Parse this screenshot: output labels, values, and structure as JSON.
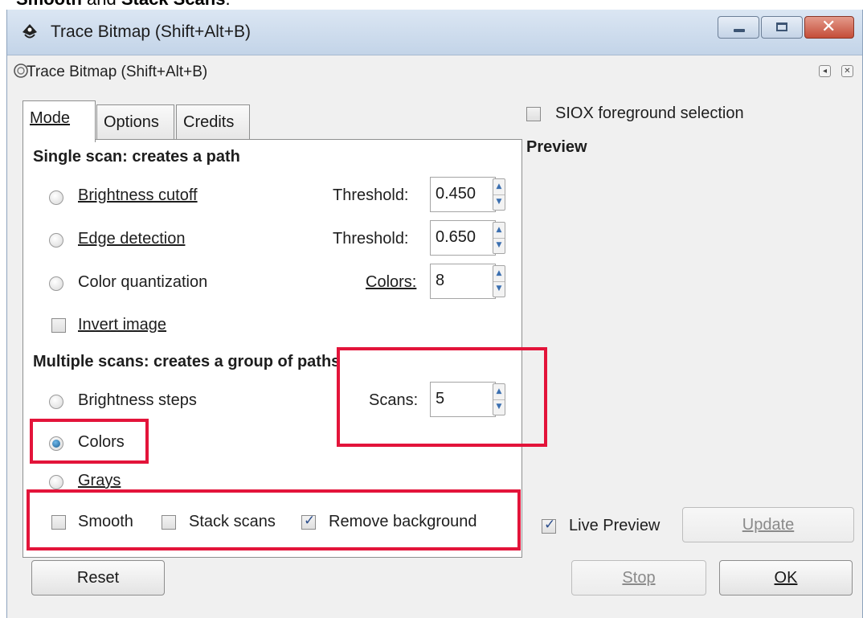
{
  "caption": {
    "part1": "Smooth",
    "part2": " and ",
    "part3": "Stack Scans",
    "part4": "."
  },
  "window": {
    "title": "Trace Bitmap (Shift+Alt+B)"
  },
  "dock": {
    "title": "Trace Bitmap (Shift+Alt+B)"
  },
  "tabs": {
    "mode": "Mode",
    "options": "Options",
    "credits": "Credits"
  },
  "single_scan": {
    "heading": "Single scan: creates a path",
    "brightness_label": "Brightness cutoff",
    "brightness_threshold_label": "Threshold:",
    "brightness_threshold_value": "0.450",
    "edge_label": "Edge detection",
    "edge_threshold_label": "Threshold:",
    "edge_threshold_value": "0.650",
    "quant_label": "Color quantization",
    "quant_colors_label": "Colors:",
    "quant_colors_value": "8",
    "invert_label": "Invert image"
  },
  "multi_scan": {
    "heading": "Multiple scans: creates a group of paths",
    "brightness_steps_label": "Brightness steps",
    "scans_label": "Scans:",
    "scans_value": "5",
    "colors_label": "Colors",
    "grays_label": "Grays",
    "smooth_label": "Smooth",
    "stack_label": "Stack scans",
    "remove_bg_label": "Remove background"
  },
  "right": {
    "siox_label": "SIOX foreground selection",
    "preview_heading": "Preview",
    "live_preview_label": "Live Preview",
    "update_label": "Update"
  },
  "buttons": {
    "reset": "Reset",
    "stop": "Stop",
    "ok": "OK"
  },
  "state": {
    "mode_selected": "Colors",
    "invert_checked": false,
    "smooth_checked": false,
    "stack_checked": false,
    "remove_bg_checked": true,
    "siox_checked": false,
    "live_preview_checked": true
  },
  "colors": {
    "highlight": "#e3143a",
    "check_mark": "#2c4e8c",
    "radio_selected": "#1a5e93"
  },
  "icons": {
    "window": "inkscape-logo-icon",
    "dock": "trace-bitmap-icon"
  }
}
